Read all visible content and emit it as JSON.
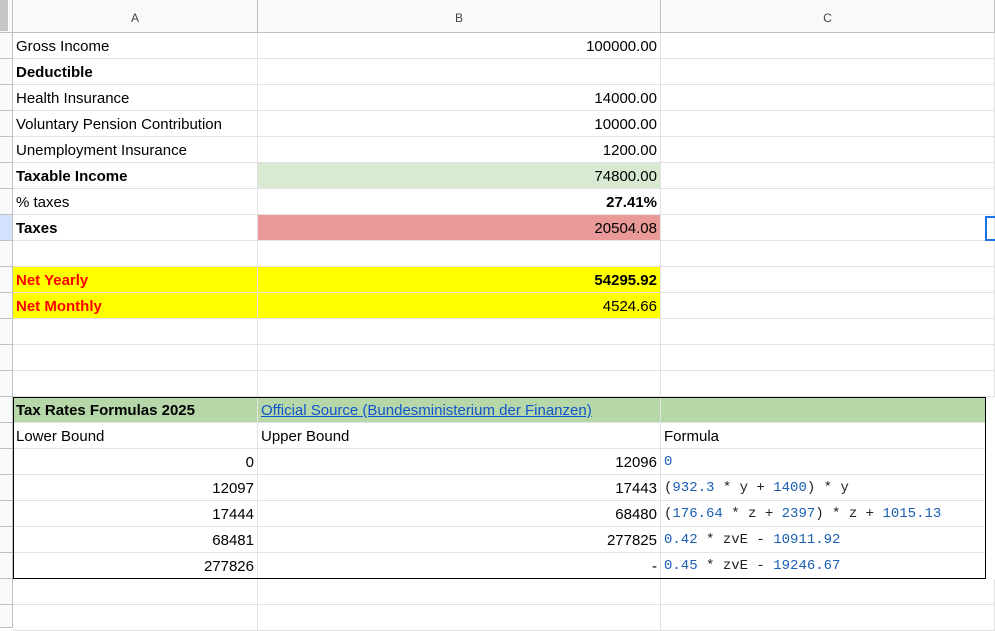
{
  "columns": [
    "A",
    "B",
    "C"
  ],
  "summary": {
    "gross_income_label": "Gross Income",
    "gross_income_value": "100000.00",
    "deductible_label": "Deductible",
    "health_label": "Health Insurance",
    "health_value": "14000.00",
    "pension_label": "Voluntary Pension Contribution",
    "pension_value": "10000.00",
    "unemployment_label": "Unemployment Insurance",
    "unemployment_value": "1200.00",
    "taxable_label": "Taxable Income",
    "taxable_value": "74800.00",
    "pct_label": "% taxes",
    "pct_value": "27.41%",
    "taxes_label": "Taxes",
    "taxes_value": "20504.08",
    "net_yearly_label": "Net Yearly",
    "net_yearly_value": "54295.92",
    "net_monthly_label": "Net Monthly",
    "net_monthly_value": "4524.66"
  },
  "tax_table": {
    "title": "Tax Rates Formulas 2025",
    "source_link": "Official Source (Bundesministerium der Finanzen)",
    "headers": [
      "Lower Bound",
      "Upper Bound",
      "Formula"
    ],
    "rows": [
      {
        "lower": "0",
        "upper": "12096",
        "formula": [
          {
            "t": "0",
            "n": true
          }
        ]
      },
      {
        "lower": "12097",
        "upper": "17443",
        "formula": [
          {
            "t": "(",
            "n": false
          },
          {
            "t": "932.3",
            "n": true
          },
          {
            "t": " * y + ",
            "n": false
          },
          {
            "t": "1400",
            "n": true
          },
          {
            "t": ") * y",
            "n": false
          }
        ]
      },
      {
        "lower": "17444",
        "upper": "68480",
        "formula": [
          {
            "t": "(",
            "n": false
          },
          {
            "t": "176.64",
            "n": true
          },
          {
            "t": " * z + ",
            "n": false
          },
          {
            "t": "2397",
            "n": true
          },
          {
            "t": ") * z + ",
            "n": false
          },
          {
            "t": "1015.13",
            "n": true
          }
        ]
      },
      {
        "lower": "68481",
        "upper": "277825",
        "formula": [
          {
            "t": "0.42",
            "n": true
          },
          {
            "t": " * zvE - ",
            "n": false
          },
          {
            "t": "10911.92",
            "n": true
          }
        ]
      },
      {
        "lower": "277826",
        "upper": "-",
        "formula": [
          {
            "t": "0.45",
            "n": true
          },
          {
            "t": " * zvE - ",
            "n": false
          },
          {
            "t": "19246.67",
            "n": true
          }
        ]
      }
    ]
  }
}
